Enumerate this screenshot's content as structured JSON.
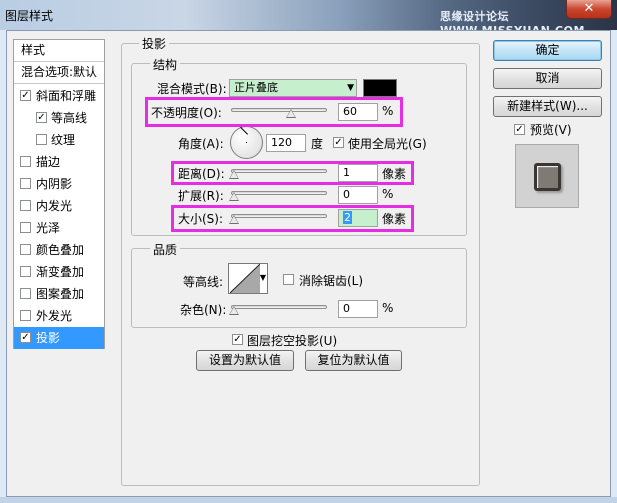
{
  "window": {
    "title": "图层样式",
    "watermark": "思缘设计论坛 WWW.MISSYUAN.COM",
    "close_glyph": "✕"
  },
  "styles_list": {
    "header": "样式",
    "blend_options": "混合选项:默认",
    "items": [
      {
        "label": "斜面和浮雕",
        "checked": true
      },
      {
        "label": "等高线",
        "checked": true
      },
      {
        "label": "纹理",
        "checked": false
      },
      {
        "label": "描边",
        "checked": false
      },
      {
        "label": "内阴影",
        "checked": false
      },
      {
        "label": "内发光",
        "checked": false
      },
      {
        "label": "光泽",
        "checked": false
      },
      {
        "label": "颜色叠加",
        "checked": false
      },
      {
        "label": "渐变叠加",
        "checked": false
      },
      {
        "label": "图案叠加",
        "checked": false
      },
      {
        "label": "外发光",
        "checked": false
      },
      {
        "label": "投影",
        "checked": true,
        "selected": true
      }
    ]
  },
  "buttons": {
    "ok": "确定",
    "cancel": "取消",
    "new_style": "新建样式(W)...",
    "preview_label": "预览(V)",
    "preview_checked": true
  },
  "drop_shadow": {
    "section_title": "投影",
    "structure": {
      "title": "结构",
      "blend_mode_label": "混合模式(B):",
      "blend_mode_value": "正片叠底",
      "shadow_color": "#000000",
      "opacity_label": "不透明度(O):",
      "opacity_value": "60",
      "opacity_unit": "%",
      "opacity_fraction": 0.6,
      "angle_label": "角度(A):",
      "angle_value": "120",
      "angle_unit": "度",
      "global_light_label": "使用全局光(G)",
      "global_light_checked": true,
      "distance_label": "距离(D):",
      "distance_value": "1",
      "distance_unit": "像素",
      "spread_label": "扩展(R):",
      "spread_value": "0",
      "spread_unit": "%",
      "size_label": "大小(S):",
      "size_value": "2",
      "size_unit": "像素"
    },
    "quality": {
      "title": "品质",
      "contour_label": "等高线:",
      "anti_alias_label": "消除锯齿(L)",
      "anti_alias_checked": false,
      "noise_label": "杂色(N):",
      "noise_value": "0",
      "noise_unit": "%"
    },
    "knockout_label": "图层挖空投影(U)",
    "knockout_checked": true,
    "make_default": "设置为默认值",
    "reset_default": "复位为默认值"
  },
  "colors": {
    "highlight": "#e62de3",
    "selection": "#3399ff",
    "input_green": "#c6efce"
  }
}
